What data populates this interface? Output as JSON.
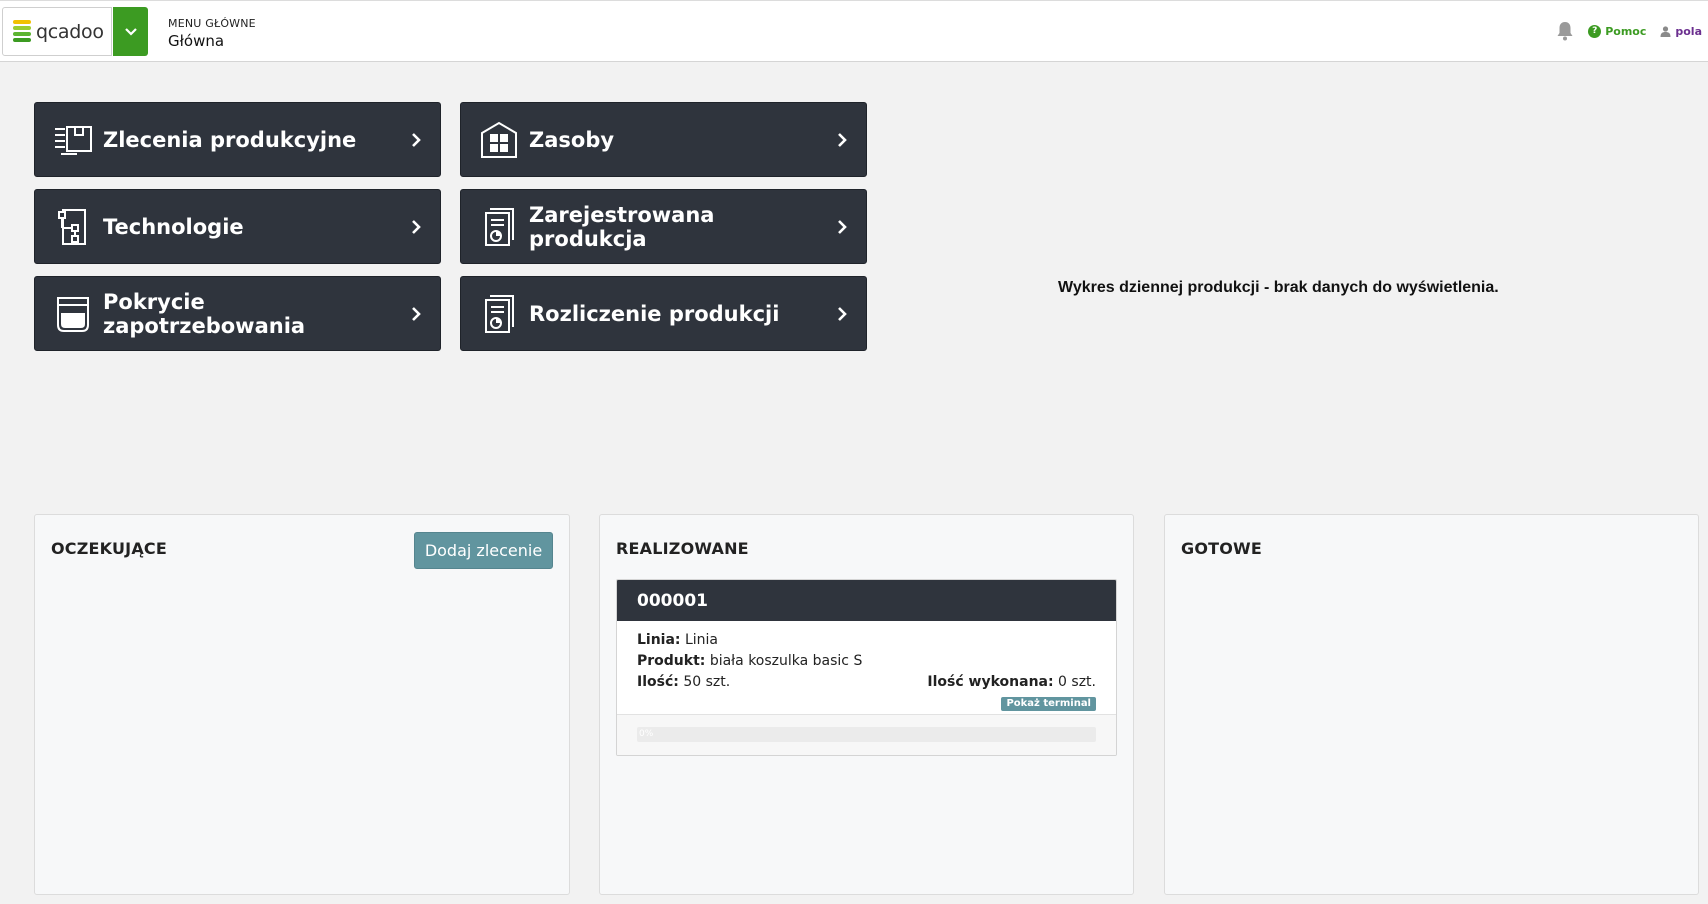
{
  "header": {
    "logo_text": "qcadoo",
    "menu_section": "MENU GŁÓWNE",
    "page_title": "Główna",
    "help_label": "Pomoc",
    "user_label": "pola"
  },
  "tiles": [
    {
      "label": "Zlecenia produkcyjne",
      "icon": "production-orders-icon"
    },
    {
      "label": "Zasoby",
      "icon": "resources-warehouse-icon"
    },
    {
      "label": "Technologie",
      "icon": "technologies-icon"
    },
    {
      "label": "Zarejestrowana produkcja",
      "icon": "registered-production-icon"
    },
    {
      "label": "Pokrycie zapotrzebowania",
      "icon": "demand-coverage-icon"
    },
    {
      "label": "Rozliczenie produkcji",
      "icon": "production-settlement-icon"
    }
  ],
  "chart_message": "Wykres dziennej produkcji - brak danych do wyświetlenia.",
  "columns": {
    "pending": {
      "title": "OCZEKUJĄCE",
      "add_button": "Dodaj zlecenie"
    },
    "in_progress": {
      "title": "REALIZOWANE",
      "orders": [
        {
          "number": "000001",
          "line_label": "Linia:",
          "line_value": "Linia",
          "product_label": "Produkt:",
          "product_value": "biała koszulka basic S",
          "quantity_label": "Ilość:",
          "quantity_value": "50 szt.",
          "done_label": "Ilość wykonana:",
          "done_value": "0 szt.",
          "terminal_button": "Pokaż terminal",
          "progress_text": "0%",
          "progress_fraction": 0
        }
      ]
    },
    "done": {
      "title": "GOTOWE"
    }
  },
  "colors": {
    "accent_green": "#3c9b22",
    "tile_bg": "#2f343d",
    "teal_button": "#61959f",
    "user_purple": "#6b2f8f"
  }
}
